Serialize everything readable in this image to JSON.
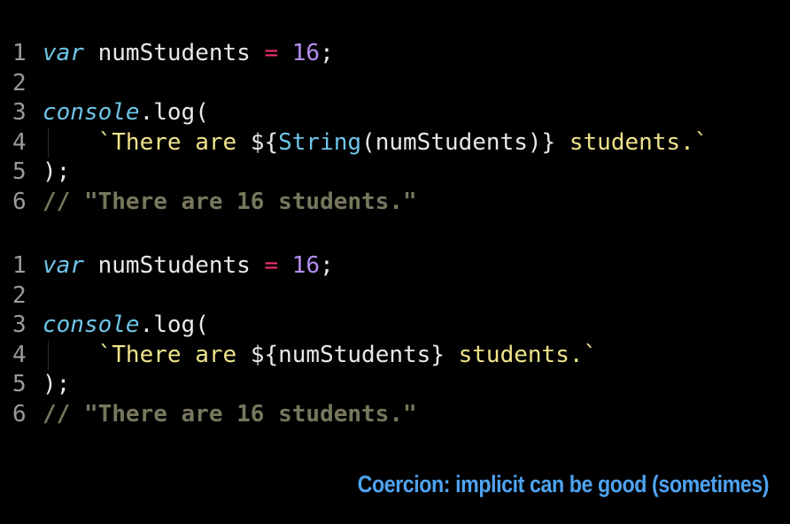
{
  "block1": {
    "lines": [
      {
        "num": "1",
        "var_kw": "var",
        "name": " numStudents ",
        "op": "=",
        "space": " ",
        "value": "16",
        "end": ";"
      },
      {
        "num": "2"
      },
      {
        "num": "3",
        "obj": "console",
        "rest": ".log("
      },
      {
        "num": "4",
        "indent": "    ",
        "str_start": "`There are ",
        "interp_open": "${",
        "fn": "String",
        "args": "(numStudents)",
        "interp_close": "}",
        "str_end": " students.`"
      },
      {
        "num": "5",
        "text": ");"
      },
      {
        "num": "6",
        "comment": "// \"There are 16 students.\""
      }
    ]
  },
  "block2": {
    "lines": [
      {
        "num": "1",
        "var_kw": "var",
        "name": " numStudents ",
        "op": "=",
        "space": " ",
        "value": "16",
        "end": ";"
      },
      {
        "num": "2"
      },
      {
        "num": "3",
        "obj": "console",
        "rest": ".log("
      },
      {
        "num": "4",
        "indent": "    ",
        "str_start": "`There are ",
        "interp": "${numStudents}",
        "str_end": " students.`"
      },
      {
        "num": "5",
        "text": ");"
      },
      {
        "num": "6",
        "comment": "// \"There are 16 students.\""
      }
    ]
  },
  "caption": "Coercion: implicit can be good (sometimes)",
  "colors": {
    "background": "#000000",
    "keyword": "#6ec6e8",
    "operator": "#f0306a",
    "number": "#b48ef0",
    "string": "#f0e38a",
    "comment": "#77775e",
    "caption": "#4fa3f0"
  }
}
